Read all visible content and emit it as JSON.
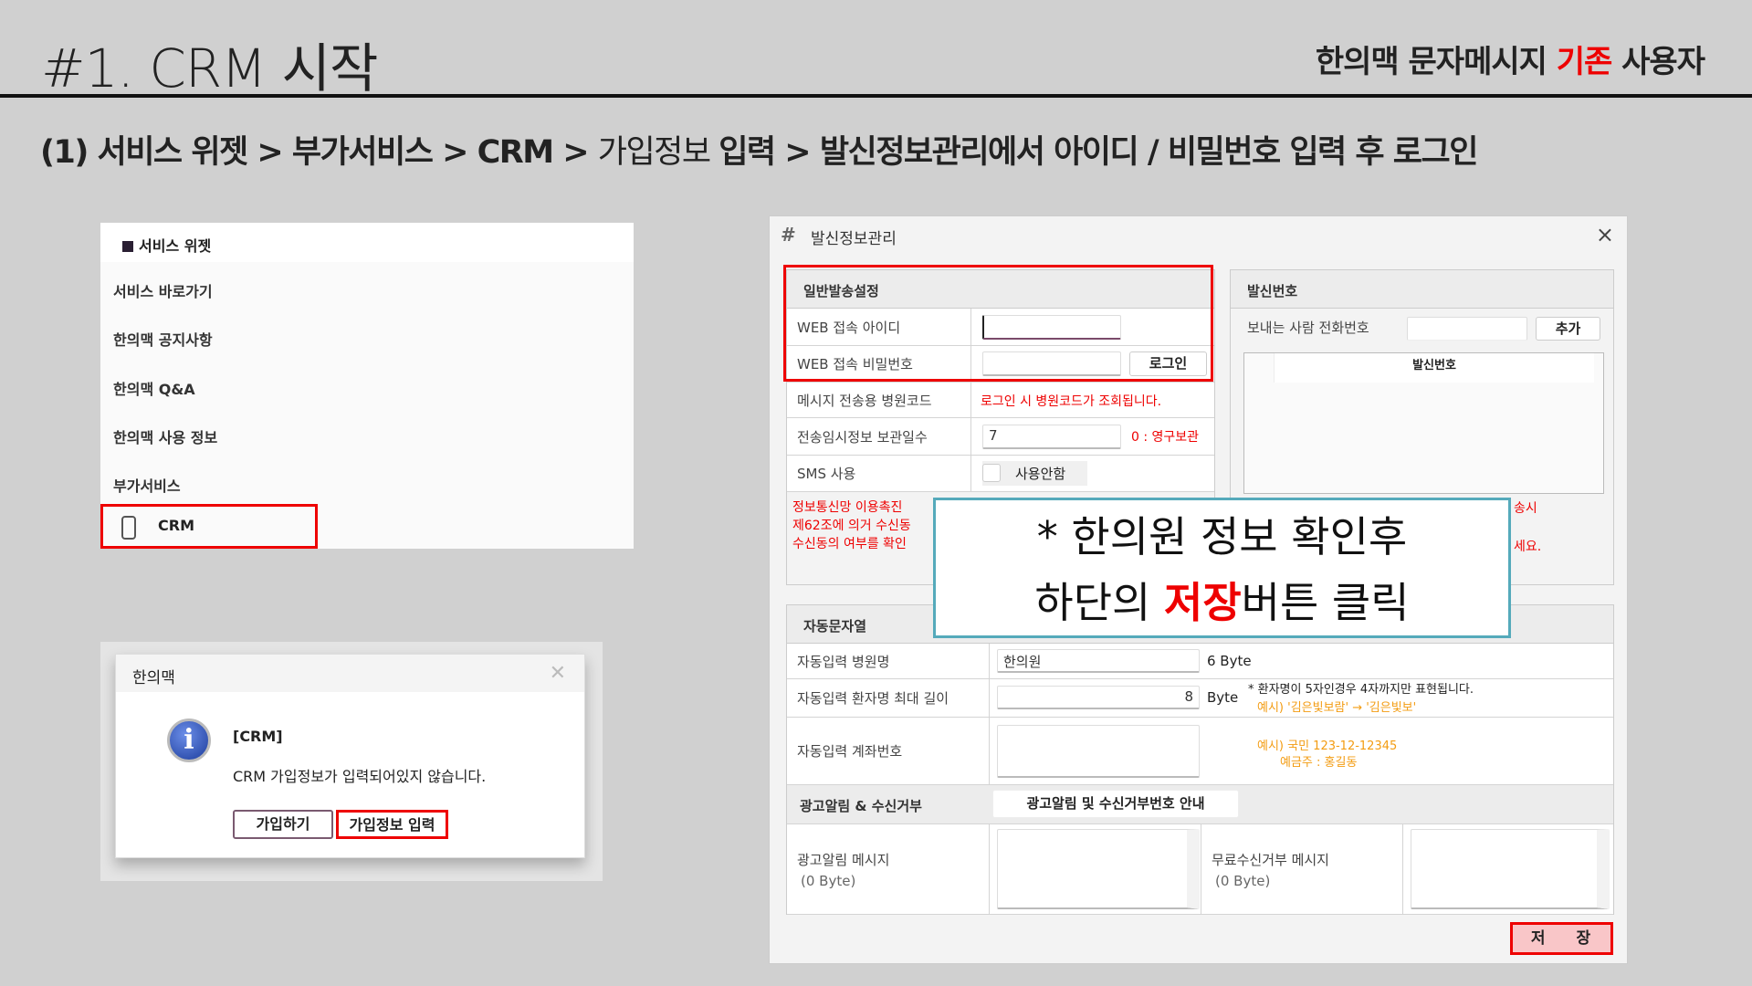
{
  "header": {
    "title": "#1. CRM 시작",
    "right_pre": "한의맥 문자메시지 ",
    "right_hl": "기존",
    "right_post": " 사용자"
  },
  "subtitle": {
    "p1": "(1)  서비스 위젯 > 부가서비스 > CRM  > ",
    "p2": "가입정보 ",
    "p3": "입력  > 발신정보관리에서 아이디 / 비밀번호 입력 후 로그인"
  },
  "widget": {
    "title": "서비스 위젯",
    "items": [
      "서비스 바로가기",
      "한의맥 공지사항",
      "한의맥 Q&A",
      "한의맥 사용 정보",
      "부가서비스"
    ],
    "crm": "CRM"
  },
  "alert": {
    "title": "한의맥",
    "heading": "[CRM]",
    "message": "CRM 가입정보가 입력되어있지 않습니다.",
    "join": "가입하기",
    "info": "가입정보 입력"
  },
  "win": {
    "title": "발신정보관리",
    "close": "×",
    "general": {
      "title": "일반발송설정",
      "id_label": "WEB 접속 아이디",
      "id_value": "",
      "pw_label": "WEB 접속 비밀번호",
      "pw_value": "",
      "login": "로그인",
      "code_label": "메시지 전송용 병원코드",
      "code_note": "로그인 시 병원코드가 조회됩니다.",
      "keep_label": "전송임시정보 보관일수",
      "keep_value": "7",
      "keep_note": "0 : 영구보관",
      "sms_label": "SMS 사용",
      "sms_option": "사용안함",
      "notice": [
        "정보통신망 이용촉진",
        "제62조에 의거 수신동",
        "수신동의 여부를 확인"
      ]
    },
    "sender": {
      "title": "발신번호",
      "phone_label": "보내는 사람 전화번호",
      "phone_value": "",
      "add": "추가",
      "col": "발신번호",
      "note_tail": [
        "송시",
        "세요."
      ]
    },
    "auto": {
      "title": "자동문자열",
      "name_label": "자동입력 병원명",
      "name_value": "한의원",
      "name_bytes": "6 Byte",
      "len_label": "자동입력 환자명 최대 길이",
      "len_value": "8",
      "len_unit": "Byte",
      "len_note": "* 환자명이 5자인경우 4자까지만 표현됩니다.",
      "len_example": "예시) '김은빛보람' → '김은빛보'",
      "acct_label": "자동입력 계좌번호",
      "acct_value": "",
      "acct_ex1": "예시) 국민 123-12-12345",
      "acct_ex2": "예금주 : 홍길동",
      "ad_label": "광고알림 & 수신거부",
      "ad_btn": "광고알림 및 수신거부번호 안내",
      "admsg_label": "광고알림 메시지",
      "admsg_bytes": "(0 Byte)",
      "reject_label": "무료수신거부 메시지",
      "reject_bytes": "(0 Byte)"
    },
    "save": "저 장"
  },
  "callout": {
    "line1": "* 한의원 정보 확인후",
    "l2a": "하단의 ",
    "l2b": "저장",
    "l2c": "버튼 클릭"
  }
}
